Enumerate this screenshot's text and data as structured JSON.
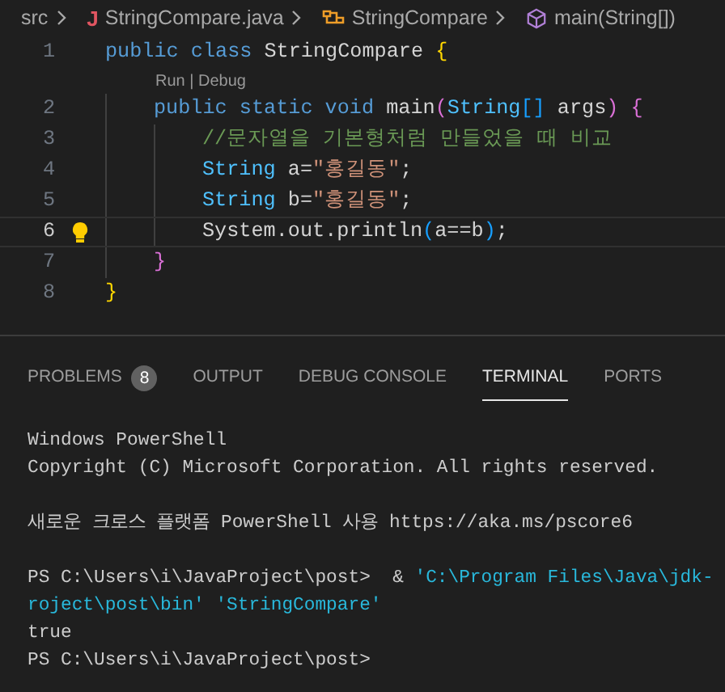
{
  "breadcrumb": [
    {
      "kind": "folder",
      "label": "src"
    },
    {
      "kind": "java",
      "icon_text": "J",
      "label": "StringCompare.java"
    },
    {
      "kind": "class",
      "label": "StringCompare"
    },
    {
      "kind": "method",
      "label": "main(String[])"
    }
  ],
  "editor": {
    "lines": [
      {
        "number": "1",
        "active": false,
        "lightbulb": false,
        "tokens": [
          {
            "kind": "kw",
            "text": "public class "
          },
          {
            "kind": "plain",
            "text": "StringCompare "
          },
          {
            "kind": "gold",
            "text": "{"
          }
        ]
      },
      {
        "number": "2",
        "active": false,
        "lightbulb": false,
        "codelens": "Run | Debug",
        "tokens": [
          {
            "kind": "kw",
            "text": "    public static void "
          },
          {
            "kind": "plain",
            "text": "main"
          },
          {
            "kind": "pink",
            "text": "("
          },
          {
            "kind": "type",
            "text": "String"
          },
          {
            "kind": "blue",
            "text": "[]"
          },
          {
            "kind": "plain",
            "text": " args"
          },
          {
            "kind": "pink",
            "text": ")"
          },
          {
            "kind": "pink",
            "text": " {"
          }
        ]
      },
      {
        "number": "3",
        "active": false,
        "lightbulb": false,
        "tokens": [
          {
            "kind": "comment",
            "text": "        //문자열을 기본형처럼 만들었을 때 비교"
          }
        ]
      },
      {
        "number": "4",
        "active": false,
        "lightbulb": false,
        "tokens": [
          {
            "kind": "type",
            "text": "        String"
          },
          {
            "kind": "plain",
            "text": " a="
          },
          {
            "kind": "string",
            "text": "\"홍길동\""
          },
          {
            "kind": "plain",
            "text": ";"
          }
        ]
      },
      {
        "number": "5",
        "active": false,
        "lightbulb": false,
        "tokens": [
          {
            "kind": "type",
            "text": "        String"
          },
          {
            "kind": "plain",
            "text": " b="
          },
          {
            "kind": "string",
            "text": "\"홍길동\""
          },
          {
            "kind": "plain",
            "text": ";"
          }
        ]
      },
      {
        "number": "6",
        "active": true,
        "lightbulb": true,
        "tokens": [
          {
            "kind": "plain",
            "text": "        System.out.println"
          },
          {
            "kind": "blue",
            "text": "("
          },
          {
            "kind": "plain",
            "text": "a==b"
          },
          {
            "kind": "blue",
            "text": ")"
          },
          {
            "kind": "plain",
            "text": ";"
          }
        ]
      },
      {
        "number": "7",
        "active": false,
        "lightbulb": false,
        "tokens": [
          {
            "kind": "pink",
            "text": "    }"
          }
        ]
      },
      {
        "number": "8",
        "active": false,
        "lightbulb": false,
        "tokens": [
          {
            "kind": "gold",
            "text": "}"
          }
        ]
      }
    ]
  },
  "panel": {
    "tabs": [
      {
        "label": "PROBLEMS",
        "badge": "8",
        "selected": false
      },
      {
        "label": "OUTPUT",
        "selected": false
      },
      {
        "label": "DEBUG CONSOLE",
        "selected": false
      },
      {
        "label": "TERMINAL",
        "selected": true
      },
      {
        "label": "PORTS",
        "selected": false
      }
    ],
    "terminal": [
      [
        [
          {
            "kind": "plain",
            "text": "Windows PowerShell"
          }
        ],
        [
          {
            "kind": "plain",
            "text": "Copyright (C) Microsoft Corporation. All rights reserved."
          }
        ]
      ],
      [
        [
          {
            "kind": "plain",
            "text": "새로운 크로스 플랫폼 PowerShell 사용 https://aka.ms/pscore6"
          }
        ]
      ],
      [
        [
          {
            "kind": "plain",
            "text": "PS C:\\Users\\i\\JavaProject\\post>  & "
          },
          {
            "kind": "string",
            "text": "'C:\\Program Files\\Java\\jdk-"
          }
        ],
        [
          {
            "kind": "string",
            "text": "roject\\post\\bin' 'StringCompare'"
          }
        ],
        [
          {
            "kind": "plain",
            "text": "true"
          }
        ],
        [
          {
            "kind": "plain",
            "text": "PS C:\\Users\\i\\JavaProject\\post>"
          }
        ]
      ]
    ]
  }
}
